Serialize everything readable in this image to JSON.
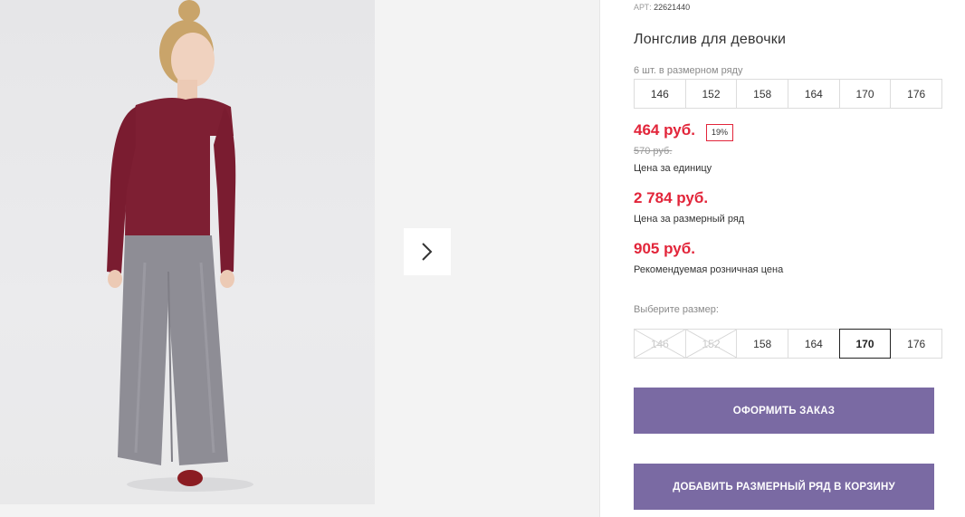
{
  "product": {
    "sku_label": "АРТ:",
    "sku_value": "22621440",
    "title": "Лонгслив для девочки"
  },
  "size_row": {
    "caption": "6 шт. в размерном ряду",
    "sizes": [
      "146",
      "152",
      "158",
      "164",
      "170",
      "176"
    ]
  },
  "prices": {
    "unit_price": "464 руб.",
    "discount": "19%",
    "old_price": "570 руб.",
    "unit_label": "Цена за единицу",
    "row_price": "2 784 руб.",
    "row_label": "Цена за размерный ряд",
    "retail_price": "905 руб.",
    "retail_label": "Рекомендуемая розничная цена"
  },
  "size_picker": {
    "caption": "Выберите размер:",
    "sizes": [
      "146",
      "152",
      "158",
      "164",
      "170",
      "176"
    ],
    "disabled": [
      "146",
      "152"
    ],
    "selected": "170"
  },
  "actions": {
    "order_label": "ОФОРМИТЬ ЗАКАЗ",
    "add_row_label": "ДОБАВИТЬ РАЗМЕРНЫЙ РЯД В КОРЗИНУ"
  },
  "icons": {
    "next": "chevron-right-icon"
  },
  "colors": {
    "price_red": "#e2253a",
    "button_purple": "#7a6aa3"
  }
}
